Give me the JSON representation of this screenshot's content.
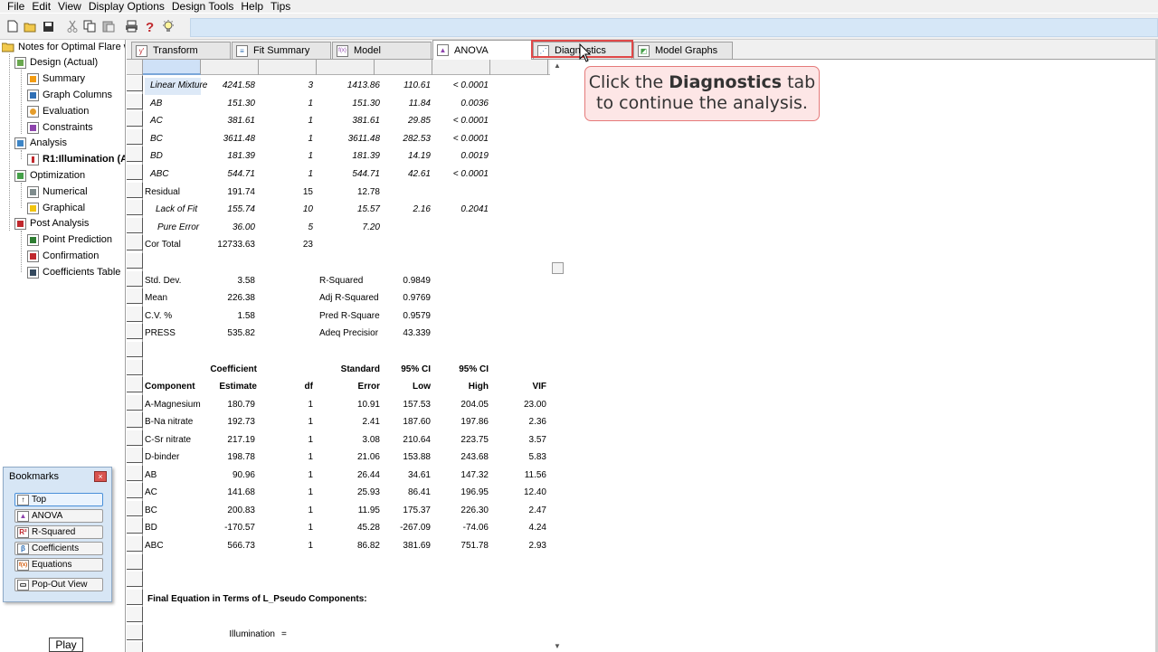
{
  "menu": [
    "File",
    "Edit",
    "View",
    "Display Options",
    "Design Tools",
    "Help",
    "Tips"
  ],
  "tree": {
    "root": "Notes for Optimal Flare wit",
    "items": [
      {
        "label": "Design (Actual)",
        "level": 1
      },
      {
        "label": "Summary",
        "level": 2
      },
      {
        "label": "Graph Columns",
        "level": 2
      },
      {
        "label": "Evaluation",
        "level": 2
      },
      {
        "label": "Constraints",
        "level": 2
      },
      {
        "label": "Analysis",
        "level": 1
      },
      {
        "label": "R1:Illumination (A",
        "level": 2
      },
      {
        "label": "Optimization",
        "level": 1
      },
      {
        "label": "Numerical",
        "level": 2
      },
      {
        "label": "Graphical",
        "level": 2
      },
      {
        "label": "Post Analysis",
        "level": 1
      },
      {
        "label": "Point Prediction",
        "level": 2
      },
      {
        "label": "Confirmation",
        "level": 2
      },
      {
        "label": "Coefficients Table",
        "level": 2
      }
    ]
  },
  "tabs": [
    "Transform",
    "Fit Summary",
    "Model",
    "ANOVA",
    "Diagnostics",
    "Model Graphs"
  ],
  "active_tab": "ANOVA",
  "callout": {
    "pre": "Click the ",
    "bold": "Diagnostics",
    "mid": " tab",
    "line2": "to continue the analysis."
  },
  "bookmarks": {
    "title": "Bookmarks",
    "close": "×",
    "items": [
      "Top",
      "ANOVA",
      "R-Squared",
      "Coefficients",
      "Equations"
    ],
    "popout": "Pop-Out View",
    "icons": [
      "↑",
      "▲",
      "R²",
      "β",
      "f(x)",
      "▭"
    ]
  },
  "play": "Play",
  "anova": [
    {
      "source": "Linear Mixture",
      "ss": "4241.58",
      "df": "3",
      "ms": "1413.86",
      "f": "110.61",
      "p": "< 0.0001"
    },
    {
      "source": "AB",
      "ss": "151.30",
      "df": "1",
      "ms": "151.30",
      "f": "11.84",
      "p": "0.0036"
    },
    {
      "source": "AC",
      "ss": "381.61",
      "df": "1",
      "ms": "381.61",
      "f": "29.85",
      "p": "< 0.0001"
    },
    {
      "source": "BC",
      "ss": "3611.48",
      "df": "1",
      "ms": "3611.48",
      "f": "282.53",
      "p": "< 0.0001"
    },
    {
      "source": "BD",
      "ss": "181.39",
      "df": "1",
      "ms": "181.39",
      "f": "14.19",
      "p": "0.0019"
    },
    {
      "source": "ABC",
      "ss": "544.71",
      "df": "1",
      "ms": "544.71",
      "f": "42.61",
      "p": "< 0.0001"
    }
  ],
  "residual": {
    "source": "Residual",
    "ss": "191.74",
    "df": "15",
    "ms": "12.78"
  },
  "lof": {
    "source": "Lack of Fit",
    "ss": "155.74",
    "df": "10",
    "ms": "15.57",
    "f": "2.16",
    "p": "0.2041"
  },
  "pure": {
    "source": "Pure Error",
    "ss": "36.00",
    "df": "5",
    "ms": "7.20"
  },
  "cortotal": {
    "source": "Cor Total",
    "ss": "12733.63",
    "df": "23"
  },
  "fit": [
    {
      "label": "Std. Dev.",
      "value": "3.58",
      "label2": "R-Squared",
      "value2": "0.9849"
    },
    {
      "label": "Mean",
      "value": "226.38",
      "label2": "Adj R-Squared",
      "value2": "0.9769"
    },
    {
      "label": "C.V. %",
      "value": "1.58",
      "label2": "Pred R-Square",
      "value2": "0.9579"
    },
    {
      "label": "PRESS",
      "value": "535.82",
      "label2": "Adeq Precisior",
      "value2": "43.339"
    }
  ],
  "coef_header1": {
    "est": "Coefficient",
    "se": "Standard",
    "low": "95% CI",
    "high": "95% CI"
  },
  "coef_header2": {
    "comp": "Component",
    "est": "Estimate",
    "df": "df",
    "se": "Error",
    "low": "Low",
    "high": "High",
    "vif": "VIF"
  },
  "coef": [
    {
      "comp": "A-Magnesium",
      "est": "180.79",
      "df": "1",
      "se": "10.91",
      "low": "157.53",
      "high": "204.05",
      "vif": "23.00"
    },
    {
      "comp": "B-Na nitrate",
      "est": "192.73",
      "df": "1",
      "se": "2.41",
      "low": "187.60",
      "high": "197.86",
      "vif": "2.36"
    },
    {
      "comp": "C-Sr nitrate",
      "est": "217.19",
      "df": "1",
      "se": "3.08",
      "low": "210.64",
      "high": "223.75",
      "vif": "3.57"
    },
    {
      "comp": "D-binder",
      "est": "198.78",
      "df": "1",
      "se": "21.06",
      "low": "153.88",
      "high": "243.68",
      "vif": "5.83"
    },
    {
      "comp": "AB",
      "est": "90.96",
      "df": "1",
      "se": "26.44",
      "low": "34.61",
      "high": "147.32",
      "vif": "11.56"
    },
    {
      "comp": "AC",
      "est": "141.68",
      "df": "1",
      "se": "25.93",
      "low": "86.41",
      "high": "196.95",
      "vif": "12.40"
    },
    {
      "comp": "BC",
      "est": "200.83",
      "df": "1",
      "se": "11.95",
      "low": "175.37",
      "high": "226.30",
      "vif": "2.47"
    },
    {
      "comp": "BD",
      "est": "-170.57",
      "df": "1",
      "se": "45.28",
      "low": "-267.09",
      "high": "-74.06",
      "vif": "4.24"
    },
    {
      "comp": "ABC",
      "est": "566.73",
      "df": "1",
      "se": "86.82",
      "low": "381.69",
      "high": "751.78",
      "vif": "2.93"
    }
  ],
  "equation_title": "Final Equation in Terms of L_Pseudo Components:",
  "equation_lhs": "Illumination",
  "equation_eq": "="
}
